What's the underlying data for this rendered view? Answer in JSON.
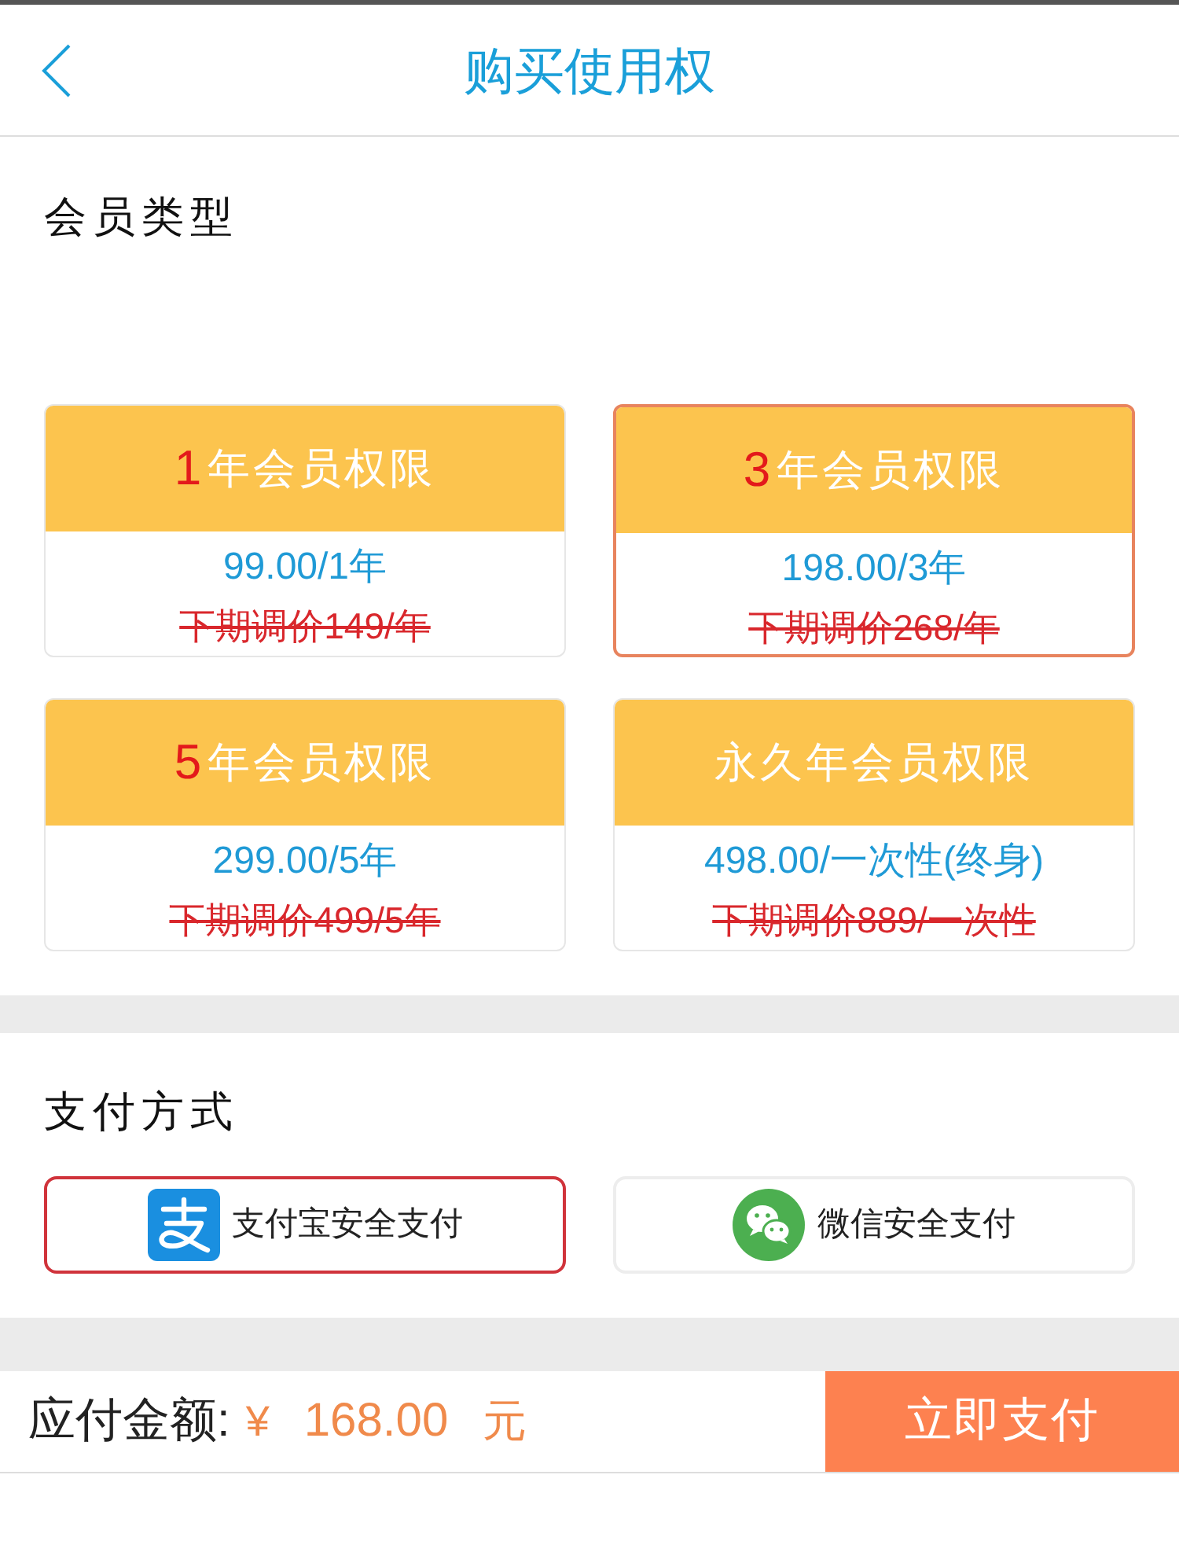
{
  "header": {
    "title": "购买使用权"
  },
  "membership": {
    "heading": "会员类型",
    "plans": [
      {
        "number": "1",
        "label": "年会员权限",
        "price": "99.00/1年",
        "old_price": "下期调价149/年",
        "selected": false
      },
      {
        "number": "3",
        "label": "年会员权限",
        "price": "198.00/3年",
        "old_price": "下期调价268/年",
        "selected": true
      },
      {
        "number": "5",
        "label": "年会员权限",
        "price": "299.00/5年",
        "old_price": "下期调价499/5年",
        "selected": false
      },
      {
        "label": "永久年会员权限",
        "price": "498.00/一次性(终身)",
        "old_price": "下期调价889/一次性",
        "selected": false
      }
    ]
  },
  "payment": {
    "heading": "支付方式",
    "methods": [
      {
        "kind": "alipay",
        "label": "支付宝安全支付",
        "selected": true
      },
      {
        "kind": "wechat",
        "label": "微信安全支付",
        "selected": false
      }
    ]
  },
  "footer": {
    "label": "应付金额:",
    "currency": "¥",
    "amount": "168.00",
    "unit": "元",
    "button": "立即支付"
  }
}
